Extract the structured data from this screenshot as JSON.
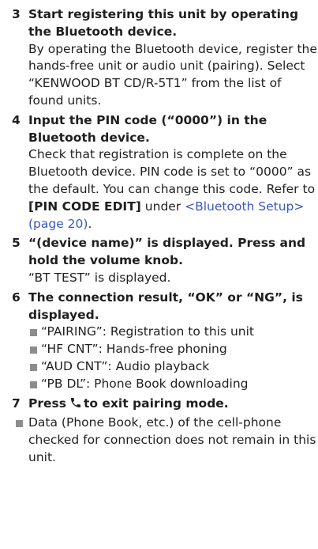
{
  "steps": [
    {
      "num": "3",
      "title": "Start registering this unit by operating the Bluetooth device.",
      "body": "By operating the Bluetooth device, register the hands-free unit or audio unit (pairing). Select “KENWOOD BT CD/R-5T1” from the list of found units."
    },
    {
      "num": "4",
      "title": "Input the PIN code (“0000”) in the Bluetooth device.",
      "body_part1": "Check that registration is complete on the Bluetooth device. PIN code is set to “0000” as the default. You can change this code. Refer to ",
      "ref": "[PIN CODE EDIT]",
      "body_part2": " under ",
      "link": "<Bluetooth Setup> (page 20)",
      "body_part3": "."
    },
    {
      "num": "5",
      "title": "“(device name)” is displayed. Press and hold the volume knob.",
      "body": "“BT TEST” is displayed."
    },
    {
      "num": "6",
      "title": "The connection result, “OK” or “NG”, is displayed.",
      "bullets": [
        "“PAIRING”: Registration to this unit",
        "“HF CNT”: Hands-free phoning",
        "“AUD CNT”: Audio playback",
        "“PB DL”: Phone Book downloading"
      ]
    },
    {
      "num": "7",
      "title_before": "Press",
      "title_after": "to exit pairing mode.",
      "icon": "phone-icon"
    }
  ],
  "note": "Data (Phone Book, etc.) of the cell-phone checked for connection does not remain in this unit.",
  "colors": {
    "text": "#1f1f1f",
    "link": "#3a56c4",
    "bullet": "#8c8c8c"
  }
}
